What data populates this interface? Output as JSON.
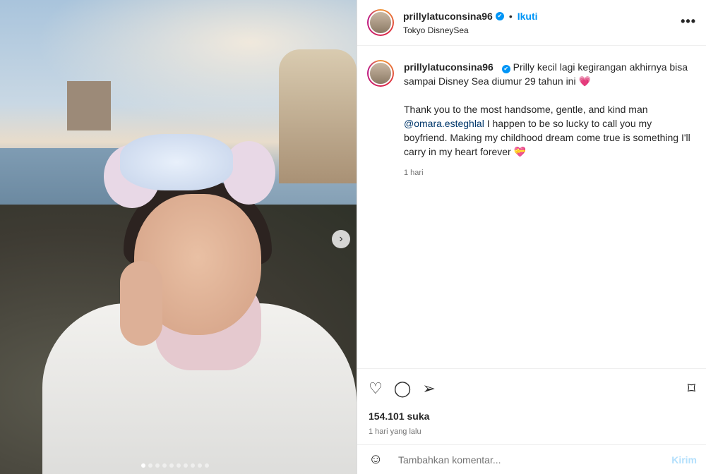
{
  "post": {
    "username": "prillylatuconsina96",
    "verified_mark": "✔",
    "separator": "•",
    "follow_label": "Ikuti",
    "location": "Tokyo DisneySea",
    "more_label": "•••",
    "next_icon": "›"
  },
  "caption": {
    "username": "prillylatuconsina96",
    "line1": "Prilly kecil lagi kegirangan akhirnya bisa sampai Disney Sea diumur 29 tahun ini",
    "line1_emoji": "💗",
    "line2_pre": "Thank you to the most handsome, gentle, and kind man",
    "mention": "@omara.esteghlal",
    "line2_post": "I happen to be so lucky to call you my boyfriend. Making my childhood dream come true is something I'll carry in my heart forever",
    "line2_emoji": "💝",
    "time": "1 hari"
  },
  "actions": {
    "like_icon": "♡",
    "comment_icon": "◯",
    "share_icon": "➢",
    "save_icon": "⌑",
    "likes": "154.101 suka",
    "ago": "1 hari yang lalu"
  },
  "comment_box": {
    "emoji_icon": "☺",
    "placeholder": "Tambahkan komentar...",
    "send_label": "Kirim"
  },
  "carousel": {
    "dot_count": 10,
    "active_index": 0
  },
  "colors": {
    "accent": "#0095f6",
    "mention": "#00376b",
    "send_disabled": "#b2dffc"
  }
}
